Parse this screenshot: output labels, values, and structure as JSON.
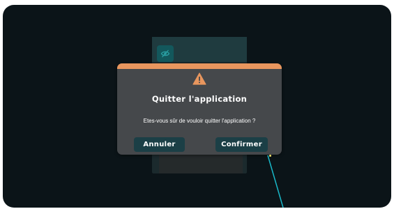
{
  "dialog": {
    "title": "Quitter l'application",
    "message": "Etes-vous sûr de vouloir quitter l'application ?",
    "cancel_label": "Annuler",
    "confirm_label": "Confirmer"
  },
  "icons": {
    "warning": "warning-triangle-icon",
    "visibility": "eye-slash-icon"
  },
  "colors": {
    "background": "#0b1418",
    "dialog_background": "#45484b",
    "accent_bar": "#e8965e",
    "button_background": "#1b3f46",
    "pointer_ray": "#19b8c8",
    "pointer_dot": "#f2e36a"
  }
}
